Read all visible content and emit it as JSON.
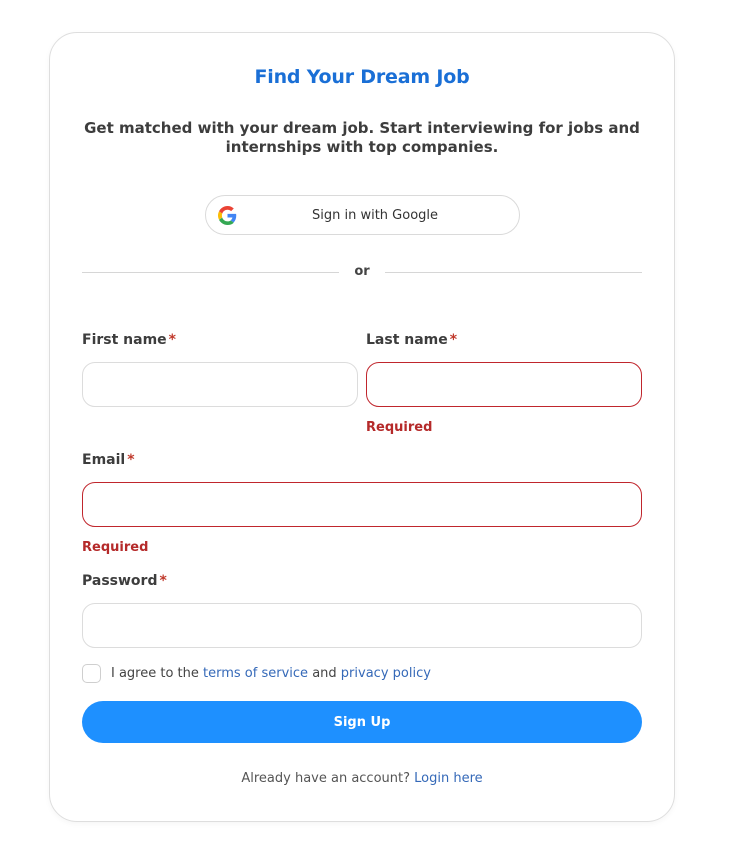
{
  "header": {
    "title": "Find Your Dream Job",
    "subtitle": "Get matched with your dream job. Start interviewing for jobs and internships with top companies."
  },
  "google": {
    "label": "Sign in with Google",
    "icon": "google-icon"
  },
  "divider": {
    "text": "or"
  },
  "form": {
    "first_name": {
      "label": "First name",
      "required_mark": "*",
      "value": ""
    },
    "last_name": {
      "label": "Last name",
      "required_mark": "*",
      "value": "",
      "error": "Required"
    },
    "email": {
      "label": "Email",
      "required_mark": "*",
      "value": "",
      "error": "Required"
    },
    "password": {
      "label": "Password",
      "required_mark": "*",
      "value": ""
    }
  },
  "agreement": {
    "prefix": "I agree to the",
    "terms_link": "terms of service",
    "middle": "and",
    "privacy_link": "privacy policy",
    "checked": false
  },
  "submit": {
    "label": "Sign Up"
  },
  "footer": {
    "prompt": "Already have an account?",
    "login_link": "Login here"
  },
  "colors": {
    "title": "#1a6fd6",
    "primary_button": "#1e90ff",
    "error": "#b52a2a",
    "link": "#3569b8"
  }
}
